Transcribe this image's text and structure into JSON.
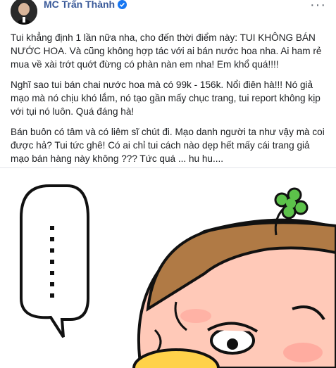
{
  "post": {
    "author": "MC Trấn Thành",
    "verified_icon": "verified-badge-icon",
    "more_label": "···",
    "paragraphs": [
      "Tui khẳng định 1 lần nữa nha, cho đến thời điểm này: TUI KHÔNG BÁN NƯỚC HOA. Và cũng không hợp tác với ai bán nước hoa nha. Ai ham rẻ mua về xài trớt quớt đừng có phàn nàn em nha! Em khổ quá!!!!",
      "Nghĩ sao tui bán chai nước hoa mà có 99k - 156k. Nổi điên hà!!! Nó giả mạo mà nó chịu khó lắm, nó tạo gần mấy chục trang, tui report không kịp với tụi nó luôn. Quá đáng hà!",
      "Bán buôn có tâm và có liêm sĩ chút đi. Mạo danh người ta như vậy mà coi được hả? Tui tức ghê! Có ai chỉ tui cách nào dẹp hết mấy cái trang giả mạo bán hàng này không ??? Tức quá ... hu hu...."
    ],
    "colors": {
      "author": "#385898",
      "text": "#1c1e21",
      "verified": "#1877f2",
      "clover": "#5cc24a",
      "hair": "#b07a45",
      "skin": "#ffc9b8"
    },
    "image_description_icons": [
      "speech-bubble",
      "clover-icon",
      "cartoon-face"
    ]
  }
}
